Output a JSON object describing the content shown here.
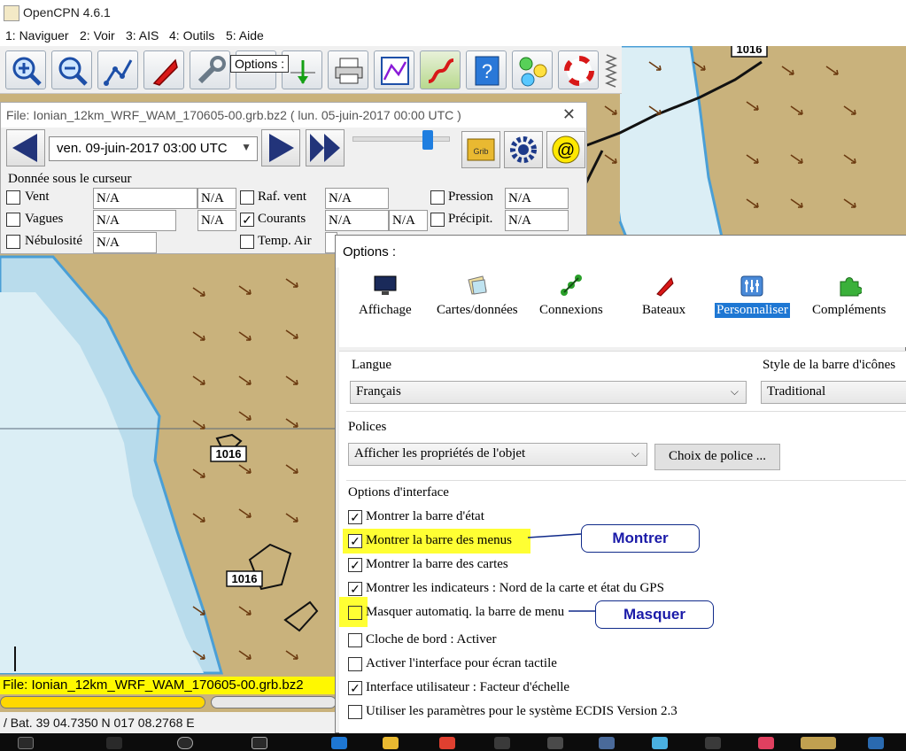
{
  "window": {
    "title": "OpenCPN 4.6.1"
  },
  "menubar": {
    "items": [
      "1: Naviguer",
      "2: Voir",
      "3: AIS",
      "4: Outils",
      "5: Aide"
    ]
  },
  "toolbar": {
    "tooltip": "Options :"
  },
  "map": {
    "label_1016": "1016"
  },
  "grib": {
    "file_title": "File: Ionian_12km_WRF_WAM_170605-00.grb.bz2 ( lun. 05-juin-2017 00:00  UTC )",
    "date": "ven. 09-juin-2017 03:00  UTC",
    "cursor_title": "Donnée sous le curseur",
    "na": "N/A",
    "rows": {
      "vent": "Vent",
      "vagues": "Vagues",
      "nebulosite": "Nébulosité",
      "raf_vent": "Raf. vent",
      "courants": "Courants",
      "temp_air": "Temp. Air",
      "pression": "Pression",
      "precipit": "Précipit."
    },
    "status_file": "File: Ionian_12km_WRF_WAM_170605-00.grb.bz2"
  },
  "statusbar": {
    "position": "/ Bat. 39 04.7350 N    017 08.2768 E"
  },
  "options": {
    "title": "Options :",
    "tabs": [
      "Affichage",
      "Cartes/données",
      "Connexions",
      "Bateaux",
      "Personnaliser",
      "Compléments"
    ],
    "selected_tab": "Personnaliser",
    "langue_label": "Langue",
    "langue_value": "Français",
    "style_label": "Style de la barre d'icônes",
    "style_value": "Traditional",
    "polices_label": "Polices",
    "polices_value": "Afficher les propriétés de l'objet",
    "choix_police": "Choix de police ...",
    "interface_label": "Options d'interface",
    "checkboxes": [
      {
        "label": "Montrer la barre d'état",
        "checked": true
      },
      {
        "label": "Montrer la barre des menus",
        "checked": true
      },
      {
        "label": "Montrer la barre des cartes",
        "checked": true
      },
      {
        "label": "Montrer les indicateurs : Nord de la carte et état du GPS",
        "checked": true
      },
      {
        "label": "Masquer automatiq. la barre de menu",
        "checked": false
      },
      {
        "label": "Cloche de bord : Activer",
        "checked": false
      },
      {
        "label": "Activer l'interface pour écran tactile",
        "checked": false
      },
      {
        "label": "Interface utilisateur : Facteur d'échelle",
        "checked": true
      },
      {
        "label": "Utiliser les paramètres pour le système ECDIS Version 2.3",
        "checked": false
      }
    ]
  },
  "callouts": {
    "montrer": "Montrer",
    "masquer": "Masquer"
  },
  "colors": {
    "land": "#c9b27c",
    "water_light": "#dbeef5",
    "water_mid": "#b9dcec",
    "water_deep": "#4a9fd6",
    "accent": "#1e77d3",
    "highlight": "#ffff33",
    "callout_text": "#1a1aa8"
  }
}
